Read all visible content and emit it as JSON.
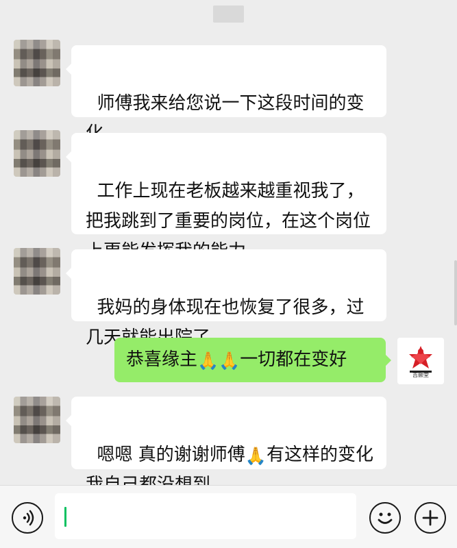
{
  "chat": {
    "messages": [
      {
        "side": "left",
        "text": "师傅我来给您说一下这段时间的变化"
      },
      {
        "side": "left",
        "text": "工作上现在老板越来越重视我了，把我跳到了重要的岗位，在这个岗位上更能发挥我的能力"
      },
      {
        "side": "left",
        "text": "我妈的身体现在也恢复了很多，过几天就能出院了"
      },
      {
        "side": "right",
        "text_before": "恭喜缘主",
        "emoji": "🙏🙏",
        "text_after": "一切都在变好"
      },
      {
        "side": "left",
        "text_before": "嗯嗯 真的谢谢师傅",
        "emoji": "🙏",
        "text_after": "有这样的变化我自己都没想到"
      }
    ]
  },
  "avatar": {
    "right_logo_text": "吉颢堂"
  },
  "input": {
    "placeholder": ""
  },
  "colors": {
    "background": "#ededed",
    "bubble_left": "#ffffff",
    "bubble_right": "#95ec69",
    "accent": "#07c160"
  },
  "icons": {
    "voice": "voice-icon",
    "emoji": "emoji-icon",
    "plus": "plus-icon"
  }
}
